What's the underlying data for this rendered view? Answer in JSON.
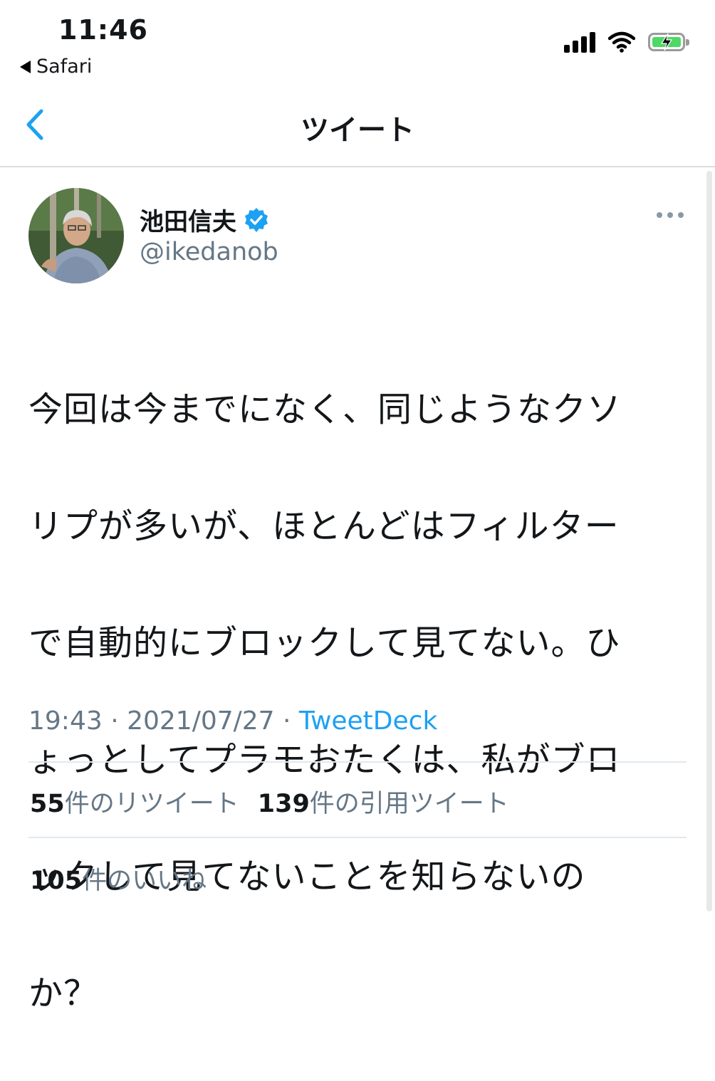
{
  "status_bar": {
    "time": "11:46",
    "back_app": "Safari",
    "signal_icon": "cellular-signal-icon",
    "wifi_icon": "wifi-icon",
    "battery_icon": "battery-charging-icon"
  },
  "nav": {
    "title": "ツイート",
    "back_icon": "chevron-left-icon"
  },
  "tweet": {
    "author_name": "池田信夫",
    "verified": true,
    "handle": "@ikedanob",
    "text_lines": [
      "今回は今までになく、同じようなクソ",
      "リプが多いが、ほとんどはフィルター",
      "で自動的にブロックして見てない。ひ",
      "ょっとしてプラモおたくは、私がブロ",
      "ックして見てないことを知らないの",
      "か？"
    ],
    "timestamp": "19:43 · 2021/07/27 · ",
    "source": "TweetDeck"
  },
  "stats": {
    "retweets_count": "55",
    "retweets_label": "件のリツイート",
    "quotes_count": "139",
    "quotes_label": "件の引用ツイート",
    "likes_count": "105",
    "likes_label": "件のいいね"
  },
  "colors": {
    "link": "#1da1f2",
    "secondary_text": "#657786",
    "verified_badge": "#1da1f2"
  }
}
